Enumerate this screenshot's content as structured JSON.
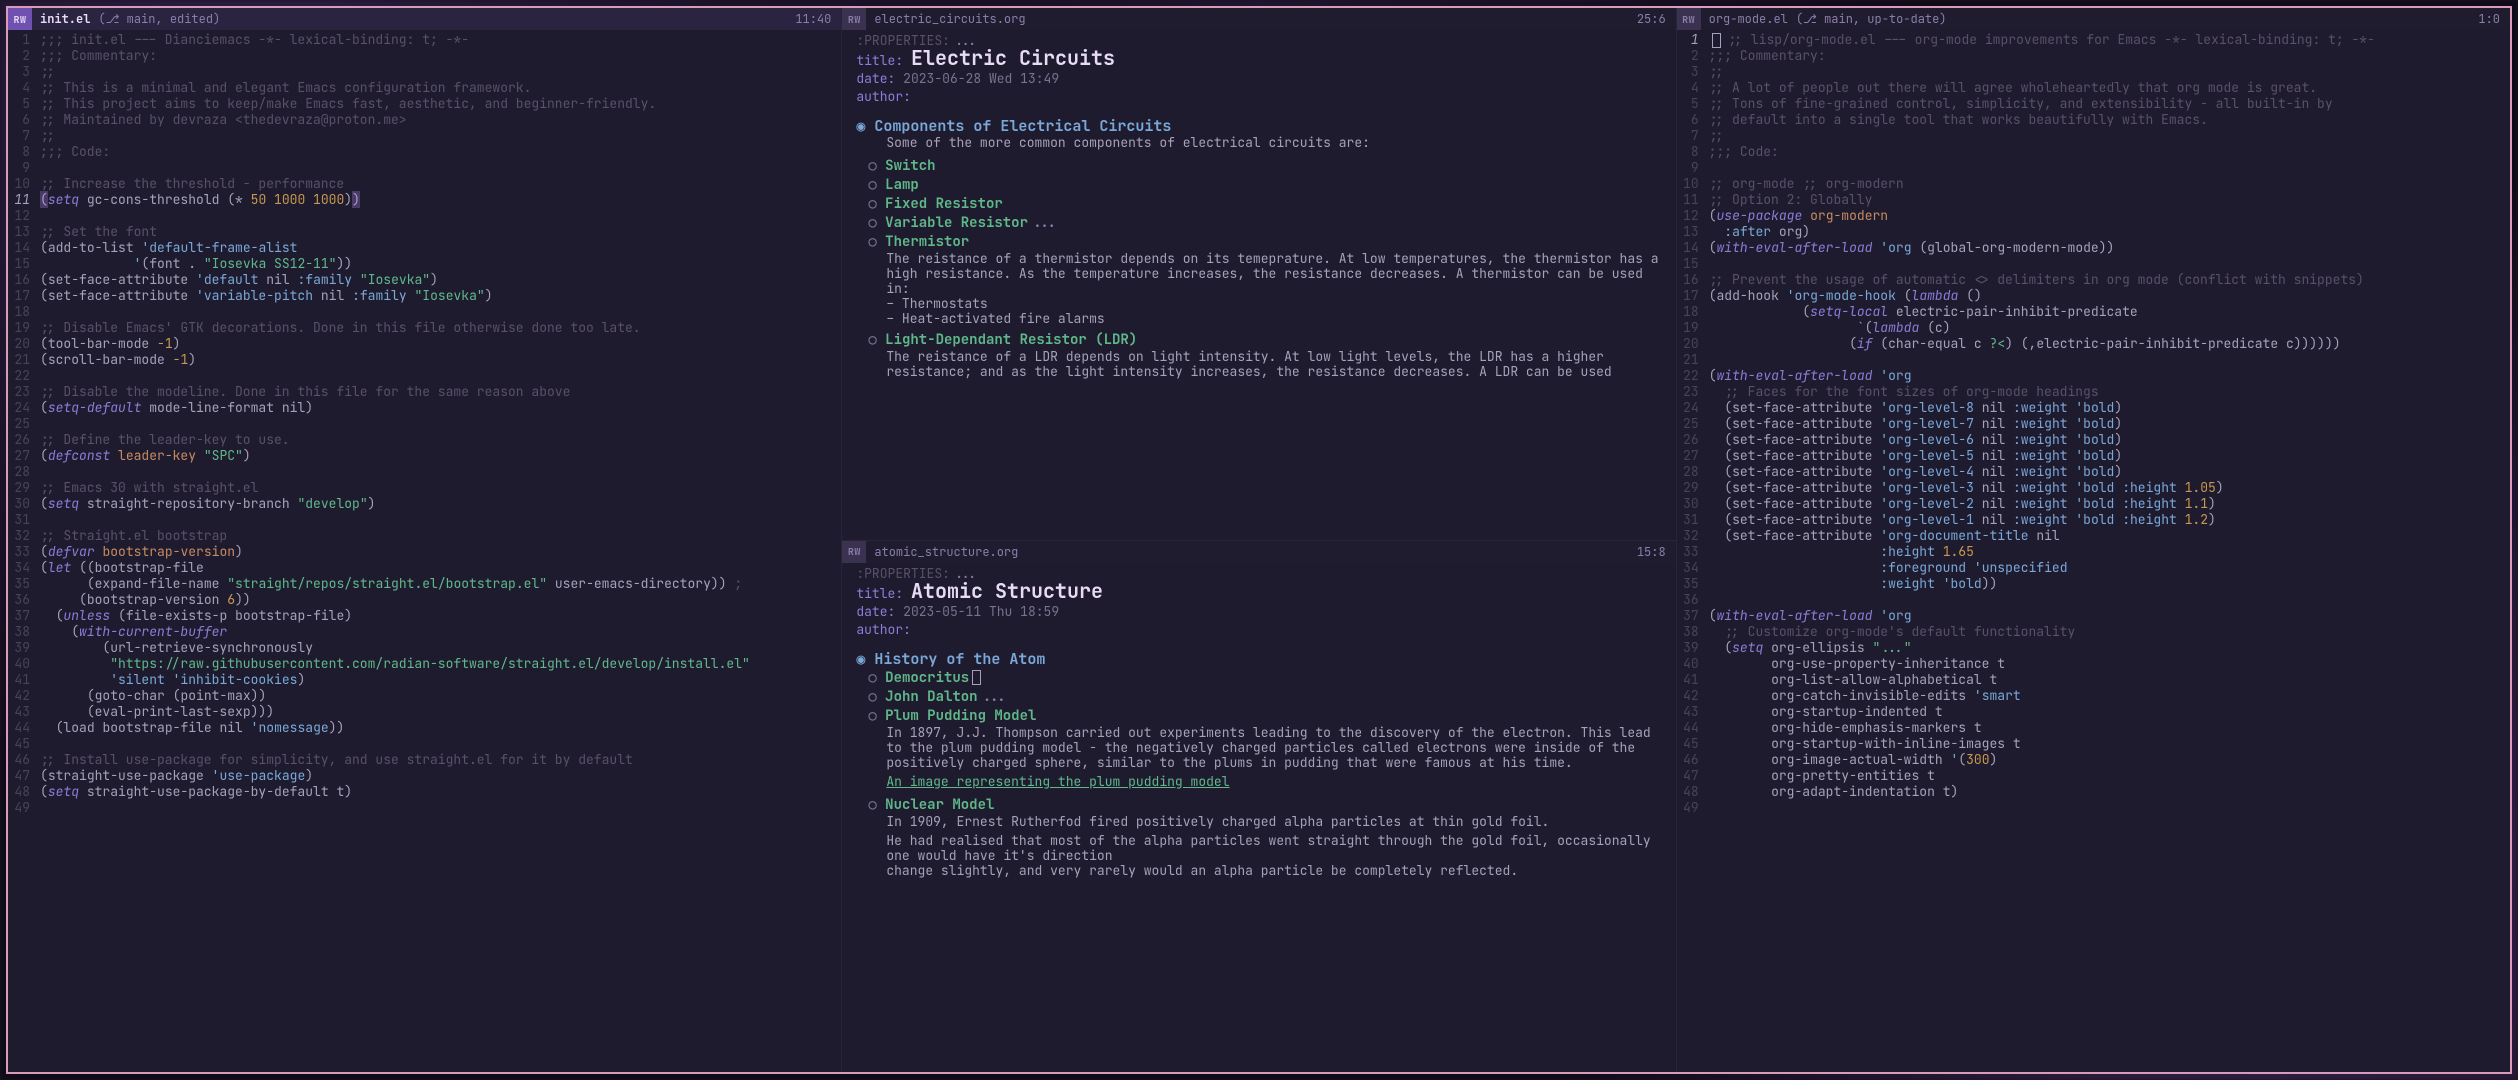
{
  "panes": {
    "left": {
      "rw": "RW",
      "filename": "init.el",
      "status": "(⎇ main, edited)",
      "pos": "11:40",
      "lines": [
        {
          "n": 1,
          "t": ";;; init.el --- Dianciemacs -*- lexical-binding: t; -*-",
          "cls": "cmt"
        },
        {
          "n": 2,
          "t": ";;; Commentary:",
          "cls": "cmt"
        },
        {
          "n": 3,
          "t": ";;",
          "cls": "cmt"
        },
        {
          "n": 4,
          "t": ";; This is a minimal and elegant Emacs configuration framework.",
          "cls": "cmt"
        },
        {
          "n": 5,
          "t": ";; This project aims to keep/make Emacs fast, aesthetic, and beginner-friendly.",
          "cls": "cmt"
        },
        {
          "n": 6,
          "t": ";; Maintained by devraza <thedevraza@proton.me>",
          "cls": "cmt"
        },
        {
          "n": 7,
          "t": ";;",
          "cls": "cmt"
        },
        {
          "n": 8,
          "t": ";;; Code:",
          "cls": "cmt"
        },
        {
          "n": 9,
          "t": "",
          "cls": ""
        },
        {
          "n": 10,
          "t": ";; Increase the threshold - performance",
          "cls": "cmt"
        },
        {
          "n": 11,
          "html": "<span class='paren-match'>(</span><span class='kw'>setq</span> <span class='sym'>gc-cons-threshold</span> <span class='prn'>(* </span><span class='num'>50 1000 1000</span><span class='prn'>)</span><span class='paren-match'>)</span>",
          "cur": true
        },
        {
          "n": 12,
          "t": "",
          "cls": ""
        },
        {
          "n": 13,
          "t": ";; Set the font",
          "cls": "cmt"
        },
        {
          "n": 14,
          "html": "<span class='prn'>(</span><span class='sym'>add-to-list</span> <span class='key'>'default-frame-alist</span>"
        },
        {
          "n": 15,
          "html": "            <span class='key'>'</span><span class='prn'>(</span><span class='sym'>font</span> . <span class='str'>\"Iosevka SS12-11\"</span><span class='prn'>))</span>"
        },
        {
          "n": 16,
          "html": "<span class='prn'>(</span><span class='sym'>set-face-attribute</span> <span class='key'>'default</span> <span class='sym'>nil</span> <span class='key'>:family</span> <span class='str'>\"Iosevka\"</span><span class='prn'>)</span>"
        },
        {
          "n": 17,
          "html": "<span class='prn'>(</span><span class='sym'>set-face-attribute</span> <span class='key'>'variable-pitch</span> <span class='sym'>nil</span> <span class='key'>:family</span> <span class='str'>\"Iosevka\"</span><span class='prn'>)</span>"
        },
        {
          "n": 18,
          "t": "",
          "cls": ""
        },
        {
          "n": 19,
          "t": ";; Disable Emacs' GTK decorations. Done in this file otherwise done too late.",
          "cls": "cmt"
        },
        {
          "n": 20,
          "html": "<span class='prn'>(</span><span class='sym'>tool-bar-mode</span> <span class='num'>-1</span><span class='prn'>)</span>"
        },
        {
          "n": 21,
          "html": "<span class='prn'>(</span><span class='sym'>scroll-bar-mode</span> <span class='num'>-1</span><span class='prn'>)</span>"
        },
        {
          "n": 22,
          "t": "",
          "cls": ""
        },
        {
          "n": 23,
          "t": ";; Disable the modeline. Done in this file for the same reason above",
          "cls": "cmt"
        },
        {
          "n": 24,
          "html": "<span class='prn'>(</span><span class='kw'>setq-default</span> <span class='sym'>mode-line-format</span> <span class='sym'>nil</span><span class='prn'>)</span>"
        },
        {
          "n": 25,
          "t": "",
          "cls": ""
        },
        {
          "n": 26,
          "t": ";; Define the leader-key to use.",
          "cls": "cmt"
        },
        {
          "n": 27,
          "html": "<span class='prn'>(</span><span class='kw'>defconst</span> <span class='var'>leader-key</span> <span class='str'>\"SPC\"</span><span class='prn'>)</span>"
        },
        {
          "n": 28,
          "t": "",
          "cls": ""
        },
        {
          "n": 29,
          "t": ";; Emacs 30 with straight.el",
          "cls": "cmt"
        },
        {
          "n": 30,
          "html": "<span class='prn'>(</span><span class='kw'>setq</span> <span class='sym'>straight-repository-branch</span> <span class='str'>\"develop\"</span><span class='prn'>)</span>"
        },
        {
          "n": 31,
          "t": "",
          "cls": ""
        },
        {
          "n": 32,
          "t": ";; Straight.el bootstrap",
          "cls": "cmt"
        },
        {
          "n": 33,
          "html": "<span class='prn'>(</span><span class='kw'>defvar</span> <span class='var'>bootstrap-version</span><span class='prn'>)</span>"
        },
        {
          "n": 34,
          "html": "<span class='prn'>(</span><span class='kw'>let</span> <span class='prn'>((</span><span class='sym'>bootstrap-file</span>"
        },
        {
          "n": 35,
          "html": "      <span class='prn'>(</span><span class='sym'>expand-file-name</span> <span class='str'>\"straight/repos/straight.el/bootstrap.el\"</span> <span class='sym'>user-emacs-directory</span><span class='prn'>))</span> <span class='cmt'>;</span>"
        },
        {
          "n": 36,
          "html": "     <span class='prn'>(</span><span class='sym'>bootstrap-version</span> <span class='num'>6</span><span class='prn'>))</span>"
        },
        {
          "n": 37,
          "html": "  <span class='prn'>(</span><span class='kw'>unless</span> <span class='prn'>(</span><span class='sym'>file-exists-p</span> <span class='sym'>bootstrap-file</span><span class='prn'>)</span>"
        },
        {
          "n": 38,
          "html": "    <span class='prn'>(</span><span class='kw'>with-current-buffer</span>"
        },
        {
          "n": 39,
          "html": "        <span class='prn'>(</span><span class='sym'>url-retrieve-synchronously</span>"
        },
        {
          "n": 40,
          "html": "         <span class='str'>\"https://raw.githubusercontent.com/radian-software/straight.el/develop/install.el\"</span>"
        },
        {
          "n": 41,
          "html": "         <span class='key'>'silent</span> <span class='key'>'inhibit-cookies</span><span class='prn'>)</span>"
        },
        {
          "n": 42,
          "html": "      <span class='prn'>(</span><span class='sym'>goto-char</span> <span class='prn'>(</span><span class='sym'>point-max</span><span class='prn'>))</span>"
        },
        {
          "n": 43,
          "html": "      <span class='prn'>(</span><span class='sym'>eval-print-last-sexp</span><span class='prn'>)))</span>"
        },
        {
          "n": 44,
          "html": "  <span class='prn'>(</span><span class='sym'>load</span> <span class='sym'>bootstrap-file</span> <span class='sym'>nil</span> <span class='key'>'nomessage</span><span class='prn'>))</span>"
        },
        {
          "n": 45,
          "t": "",
          "cls": ""
        },
        {
          "n": 46,
          "t": ";; Install use-package for simplicity, and use straight.el for it by default",
          "cls": "cmt"
        },
        {
          "n": 47,
          "html": "<span class='prn'>(</span><span class='sym'>straight-use-package</span> <span class='key'>'use-package</span><span class='prn'>)</span>"
        },
        {
          "n": 48,
          "html": "<span class='prn'>(</span><span class='kw'>setq</span> <span class='sym'>straight-use-package-by-default</span> <span class='sym'>t</span><span class='prn'>)</span>"
        },
        {
          "n": 49,
          "t": "",
          "cls": ""
        }
      ]
    },
    "midTop": {
      "rw": "RW",
      "filename": "electric_circuits.org",
      "pos": "25:6",
      "prop": ":PROPERTIES:",
      "title_kw": "title:",
      "title": "Electric Circuits",
      "date_kw": "date:",
      "date": "2023-06-28 Wed  13:49",
      "author_kw": "author:",
      "h1": "Components of Electrical Circuits",
      "body1": "Some of the more common components of electrical circuits are:",
      "items": [
        {
          "h": "Switch"
        },
        {
          "h": "Lamp"
        },
        {
          "h": "Fixed Resistor"
        },
        {
          "h": "Variable Resistor",
          "dots": "..."
        },
        {
          "h": "Thermistor",
          "body": "The reistance of a thermistor depends on its temeprature. At low temperatures, the thermistor has a high resistance. As the temperature increases, the resistance decreases. A thermistor can be used in:",
          "bullets": [
            "Thermostats",
            "Heat-activated fire alarms"
          ]
        },
        {
          "h": "Light-Dependant Resistor (LDR)",
          "body": "The reistance of a LDR depends on light intensity. At low light levels, the LDR has a higher resistance; and as the light intensity increases, the resistance decreases. A LDR can be used"
        }
      ]
    },
    "midBot": {
      "rw": "RW",
      "filename": "atomic_structure.org",
      "pos": "15:8",
      "prop": ":PROPERTIES:",
      "title_kw": "title:",
      "title": "Atomic Structure",
      "date_kw": "date:",
      "date": "2023-05-11 Thu  18:59",
      "author_kw": "author:",
      "h1": "History of the Atom",
      "items": [
        {
          "h": "Democritus",
          "cursor": true
        },
        {
          "h": "John Dalton",
          "dots": "..."
        },
        {
          "h": "Plum Pudding Model",
          "body": "In 1897, J.J. Thompson carried out experiments leading to the discovery of the electron. This lead to the plum pudding model - the negatively charged particles called electrons were inside of the positively charged sphere, similar to the plums in pudding that were famous at his time.",
          "link": "An image representing the plum pudding model"
        },
        {
          "h": "Nuclear Model",
          "body": "In 1909, Ernest Rutherfod fired positively charged alpha particles at thin gold foil.",
          "body2": "He had realised that most of the alpha particles went straight through the gold foil, occasionally one would have it's direction\nchange slightly, and very rarely would an alpha particle be completely reflected."
        }
      ]
    },
    "right": {
      "rw": "RW",
      "filename": "org-mode.el",
      "status": "(⎇ main, up-to-date)",
      "pos": "1:0",
      "lines": [
        {
          "n": 1,
          "html": "<span class='cursor'></span> <span class='cmt'>;; lisp/org-mode.el --- org-mode improvements for Emacs -*- lexical-binding: t; -*-</span>",
          "cur": true
        },
        {
          "n": 2,
          "t": ";;; Commentary:",
          "cls": "cmt"
        },
        {
          "n": 3,
          "t": ";;",
          "cls": "cmt"
        },
        {
          "n": 4,
          "t": ";; A lot of people out there will agree wholeheartedly that org mode is great.",
          "cls": "cmt"
        },
        {
          "n": 5,
          "t": ";; Tons of fine-grained control, simplicity, and extensibility - all built-in by",
          "cls": "cmt"
        },
        {
          "n": 6,
          "t": ";; default into a single tool that works beautifully with Emacs.",
          "cls": "cmt"
        },
        {
          "n": 7,
          "t": ";;",
          "cls": "cmt"
        },
        {
          "n": 8,
          "t": ";;; Code:",
          "cls": "cmt"
        },
        {
          "n": 9,
          "t": "",
          "cls": ""
        },
        {
          "n": 10,
          "t": ";; org-mode ;; org-modern",
          "cls": "cmt"
        },
        {
          "n": 11,
          "t": ";; Option 2: Globally",
          "cls": "cmt"
        },
        {
          "n": 12,
          "html": "<span class='prn'>(</span><span class='kw'>use-package</span> <span class='var'>org-modern</span>"
        },
        {
          "n": 13,
          "html": "  <span class='key'>:after</span> <span class='sym'>org</span><span class='prn'>)</span>"
        },
        {
          "n": 14,
          "html": "<span class='prn'>(</span><span class='kw'>with-eval-after-load</span> <span class='key'>'org</span> <span class='prn'>(</span><span class='sym'>global-org-modern-mode</span><span class='prn'>))</span>"
        },
        {
          "n": 15,
          "t": "",
          "cls": ""
        },
        {
          "n": 16,
          "t": ";; Prevent the usage of automatic <> delimiters in org mode (conflict with snippets)",
          "cls": "cmt"
        },
        {
          "n": 17,
          "html": "<span class='prn'>(</span><span class='sym'>add-hook</span> <span class='key'>'org-mode-hook</span> <span class='prn'>(</span><span class='kw'>lambda</span> <span class='prn'>()</span>"
        },
        {
          "n": 18,
          "html": "            <span class='prn'>(</span><span class='kw'>setq-local</span> <span class='sym'>electric-pair-inhibit-predicate</span>"
        },
        {
          "n": 19,
          "html": "                   <span class='key'>`</span><span class='prn'>(</span><span class='kw'>lambda</span> <span class='prn'>(</span><span class='sym'>c</span><span class='prn'>)</span>"
        },
        {
          "n": 20,
          "html": "                  <span class='prn'>(</span><span class='kw'>if</span> <span class='prn'>(</span><span class='sym'>char-equal c</span> <span class='str'>?<</span><span class='prn'>) (</span><span class='sym'>,electric-pair-inhibit-predicate c</span><span class='prn'>))))))</span>"
        },
        {
          "n": 21,
          "t": "",
          "cls": ""
        },
        {
          "n": 22,
          "html": "<span class='prn'>(</span><span class='kw'>with-eval-after-load</span> <span class='key'>'org</span>"
        },
        {
          "n": 23,
          "t": "  ;; Faces for the font sizes of org-mode headings",
          "cls": "cmt"
        },
        {
          "n": 24,
          "html": "  <span class='prn'>(</span><span class='sym'>set-face-attribute</span> <span class='key'>'org-level-8</span> <span class='sym'>nil</span> <span class='key'>:weight</span> <span class='key'>'bold</span><span class='prn'>)</span>"
        },
        {
          "n": 25,
          "html": "  <span class='prn'>(</span><span class='sym'>set-face-attribute</span> <span class='key'>'org-level-7</span> <span class='sym'>nil</span> <span class='key'>:weight</span> <span class='key'>'bold</span><span class='prn'>)</span>"
        },
        {
          "n": 26,
          "html": "  <span class='prn'>(</span><span class='sym'>set-face-attribute</span> <span class='key'>'org-level-6</span> <span class='sym'>nil</span> <span class='key'>:weight</span> <span class='key'>'bold</span><span class='prn'>)</span>"
        },
        {
          "n": 27,
          "html": "  <span class='prn'>(</span><span class='sym'>set-face-attribute</span> <span class='key'>'org-level-5</span> <span class='sym'>nil</span> <span class='key'>:weight</span> <span class='key'>'bold</span><span class='prn'>)</span>"
        },
        {
          "n": 28,
          "html": "  <span class='prn'>(</span><span class='sym'>set-face-attribute</span> <span class='key'>'org-level-4</span> <span class='sym'>nil</span> <span class='key'>:weight</span> <span class='key'>'bold</span><span class='prn'>)</span>"
        },
        {
          "n": 29,
          "html": "  <span class='prn'>(</span><span class='sym'>set-face-attribute</span> <span class='key'>'org-level-3</span> <span class='sym'>nil</span> <span class='key'>:weight</span> <span class='key'>'bold</span> <span class='key'>:height</span> <span class='num'>1.05</span><span class='prn'>)</span>"
        },
        {
          "n": 30,
          "html": "  <span class='prn'>(</span><span class='sym'>set-face-attribute</span> <span class='key'>'org-level-2</span> <span class='sym'>nil</span> <span class='key'>:weight</span> <span class='key'>'bold</span> <span class='key'>:height</span> <span class='num'>1.1</span><span class='prn'>)</span>"
        },
        {
          "n": 31,
          "html": "  <span class='prn'>(</span><span class='sym'>set-face-attribute</span> <span class='key'>'org-level-1</span> <span class='sym'>nil</span> <span class='key'>:weight</span> <span class='key'>'bold</span> <span class='key'>:height</span> <span class='num'>1.2</span><span class='prn'>)</span>"
        },
        {
          "n": 32,
          "html": "  <span class='prn'>(</span><span class='sym'>set-face-attribute</span> <span class='key'>'org-document-title</span> <span class='sym'>nil</span>"
        },
        {
          "n": 33,
          "html": "                      <span class='key'>:height</span> <span class='num'>1.65</span>"
        },
        {
          "n": 34,
          "html": "                      <span class='key'>:foreground</span> <span class='key'>'unspecified</span>"
        },
        {
          "n": 35,
          "html": "                      <span class='key'>:weight</span> <span class='key'>'bold</span><span class='prn'>))</span>"
        },
        {
          "n": 36,
          "t": "",
          "cls": ""
        },
        {
          "n": 37,
          "html": "<span class='prn'>(</span><span class='kw'>with-eval-after-load</span> <span class='key'>'org</span>"
        },
        {
          "n": 38,
          "t": "  ;; Customize org-mode's default functionality",
          "cls": "cmt"
        },
        {
          "n": 39,
          "html": "  <span class='prn'>(</span><span class='kw'>setq</span> <span class='sym'>org-ellipsis</span> <span class='str'>\"...\"</span>"
        },
        {
          "n": 40,
          "html": "        <span class='sym'>org-use-property-inheritance</span> <span class='sym'>t</span>"
        },
        {
          "n": 41,
          "html": "        <span class='sym'>org-list-allow-alphabetical</span> <span class='sym'>t</span>"
        },
        {
          "n": 42,
          "html": "        <span class='sym'>org-catch-invisible-edits</span> <span class='key'>'smart</span>"
        },
        {
          "n": 43,
          "html": "        <span class='sym'>org-startup-indented</span> <span class='sym'>t</span>"
        },
        {
          "n": 44,
          "html": "        <span class='sym'>org-hide-emphasis-markers</span> <span class='sym'>t</span>"
        },
        {
          "n": 45,
          "html": "        <span class='sym'>org-startup-with-inline-images</span> <span class='sym'>t</span>"
        },
        {
          "n": 46,
          "html": "        <span class='sym'>org-image-actual-width</span> <span class='key'>'</span><span class='prn'>(</span><span class='num'>300</span><span class='prn'>)</span>"
        },
        {
          "n": 47,
          "html": "        <span class='sym'>org-pretty-entities</span> <span class='sym'>t</span>"
        },
        {
          "n": 48,
          "html": "        <span class='sym'>org-adapt-indentation</span> <span class='sym'>t</span><span class='prn'>)</span>"
        },
        {
          "n": 49,
          "t": "",
          "cls": ""
        }
      ]
    }
  }
}
